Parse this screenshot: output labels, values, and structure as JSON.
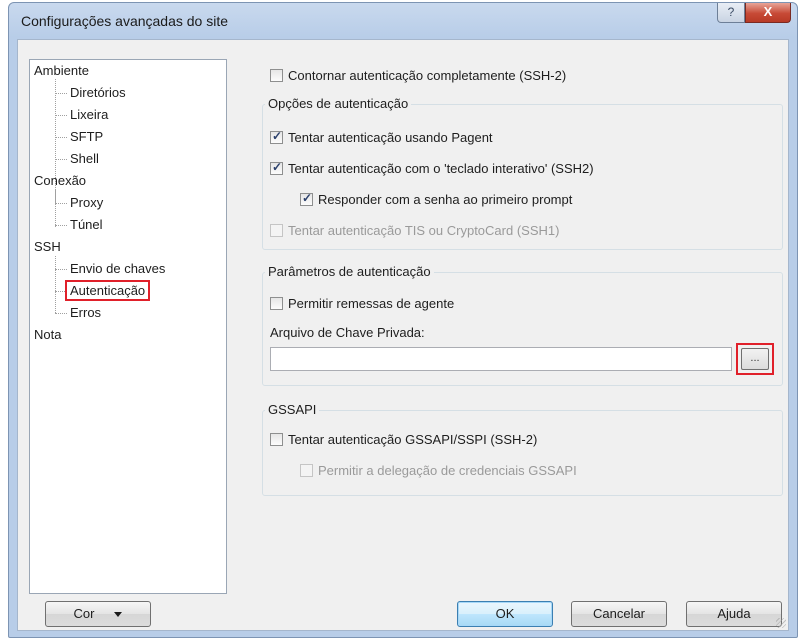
{
  "window": {
    "title": "Configurações avançadas do site",
    "help_label": "?",
    "close_label": "X"
  },
  "tree": [
    {
      "label": "Ambiente",
      "level": 0
    },
    {
      "label": "Diretórios",
      "level": 1
    },
    {
      "label": "Lixeira",
      "level": 1
    },
    {
      "label": "SFTP",
      "level": 1
    },
    {
      "label": "Shell",
      "level": 1
    },
    {
      "label": "Conexão",
      "level": 0
    },
    {
      "label": "Proxy",
      "level": 1
    },
    {
      "label": "Túnel",
      "level": 1
    },
    {
      "label": "SSH",
      "level": 0
    },
    {
      "label": "Envio de chaves",
      "level": 1
    },
    {
      "label": "Autenticação",
      "level": 1,
      "selected": true
    },
    {
      "label": "Erros",
      "level": 1
    },
    {
      "label": "Nota",
      "level": 0
    }
  ],
  "bypass": {
    "label": "Contornar autenticação completamente (SSH-2)",
    "checked": false
  },
  "auth_options": {
    "title": "Opções de autenticação",
    "pageant": {
      "label": "Tentar autenticação usando Pagent",
      "checked": true
    },
    "keyboard": {
      "label": "Tentar autenticação com o 'teclado interativo' (SSH2)",
      "checked": true
    },
    "respond": {
      "label": "Responder com a senha ao primeiro prompt",
      "checked": true
    },
    "tis": {
      "label": "Tentar autenticação TIS ou CryptoCard (SSH1)",
      "checked": false,
      "disabled": true
    }
  },
  "auth_params": {
    "title": "Parâmetros de autenticação",
    "agent_forward": {
      "label": "Permitir remessas de agente",
      "checked": false
    },
    "private_key_label": "Arquivo de Chave Privada:",
    "private_key_value": "",
    "browse_label": "..."
  },
  "gssapi": {
    "title": "GSSAPI",
    "try": {
      "label": "Tentar autenticação GSSAPI/SSPI (SSH-2)",
      "checked": false
    },
    "delegate": {
      "label": "Permitir a delegação de credenciais GSSAPI",
      "checked": false,
      "disabled": true
    }
  },
  "buttons": {
    "color": "Cor",
    "ok": "OK",
    "cancel": "Cancelar",
    "help": "Ajuda"
  },
  "colors": {
    "highlight": "#e0202a",
    "titlebar": "#b8cde8"
  }
}
